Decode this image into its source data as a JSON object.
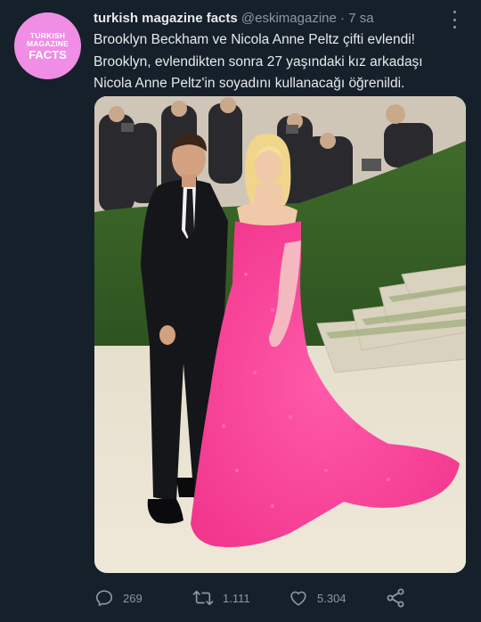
{
  "account": {
    "avatar_line1": "TURKISH",
    "avatar_line2": "MAGAZINE",
    "avatar_line3": "FACTS",
    "display_name": "turkish magazine facts",
    "handle": "@eskimagazine",
    "separator": "·",
    "time": "7 sa"
  },
  "tweet": {
    "line1": "Brooklyn Beckham ve Nicola Anne Peltz çifti evlendi!",
    "line2": "Brooklyn, evlendikten sonra 27 yaşındaki kız arkadaşı",
    "line3": "Nicola Anne Peltz'in soyadını kullanacağı öğrenildi."
  },
  "actions": {
    "replies": "269",
    "retweets": "1.111",
    "likes": "5.304"
  },
  "icons": {
    "reply": "reply-icon",
    "retweet": "retweet-icon",
    "like": "heart-icon",
    "share": "share-icon",
    "more": "more-icon"
  },
  "colors": {
    "background": "#15202b",
    "secondary_text": "#8b98a5",
    "avatar": "#ef8ee4",
    "dress": "#ff3f9a"
  }
}
